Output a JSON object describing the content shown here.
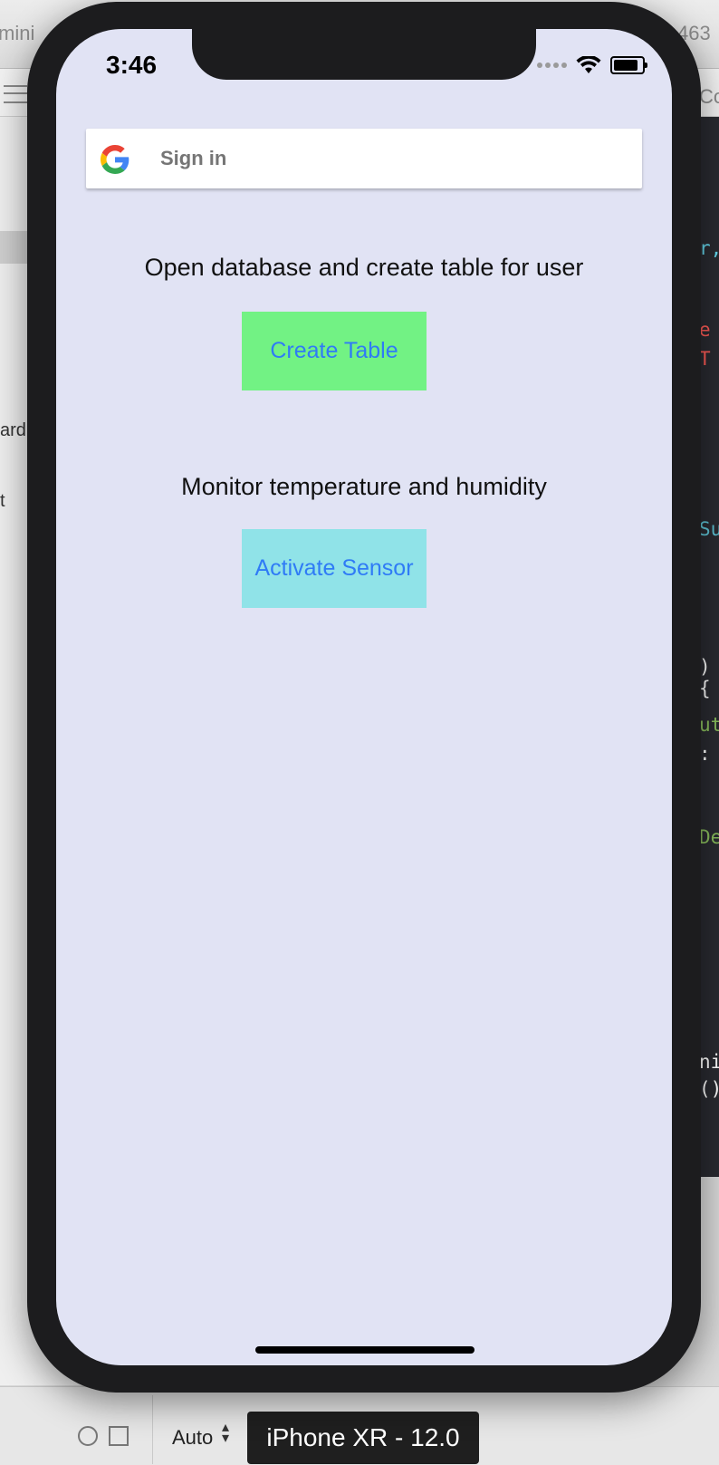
{
  "background": {
    "xcode_tab_left": "mini",
    "xcode_tab_right": "463",
    "xcode_right_fragment": "Co",
    "left_panel_texts": [
      "ard",
      "t"
    ],
    "code_fragments": [
      {
        "text": "r,",
        "color": "#66d9ef"
      },
      {
        "text": "e",
        "color": "#ff5c57"
      },
      {
        "text": "T",
        "color": "#ff5c57"
      },
      {
        "text": "Su",
        "color": "#5ec4d6"
      },
      {
        "text": "){",
        "color": "#ffffff"
      },
      {
        "text": "ut",
        "color": "#8abf5d"
      },
      {
        "text": ":",
        "color": "#ffffff"
      },
      {
        "text": "De",
        "color": "#8abf5d"
      },
      {
        "text": "ni",
        "color": "#ffffff"
      },
      {
        "text": "()",
        "color": "#ffffff"
      }
    ],
    "bottom": {
      "scheme_label": "Auto",
      "device_label": "iPhone XR - 12.0"
    }
  },
  "status_bar": {
    "time": "3:46"
  },
  "app": {
    "google_signin_label": "Sign in",
    "database_prompt": "Open database and create table for user",
    "create_table_label": "Create Table",
    "create_table_color": "#72f284",
    "monitor_prompt": "Monitor temperature and humidity",
    "activate_sensor_label": "Activate Sensor",
    "activate_sensor_color": "#90e3e8",
    "button_text_color": "#2f7bf6",
    "screen_background": "#e1e3f4"
  }
}
